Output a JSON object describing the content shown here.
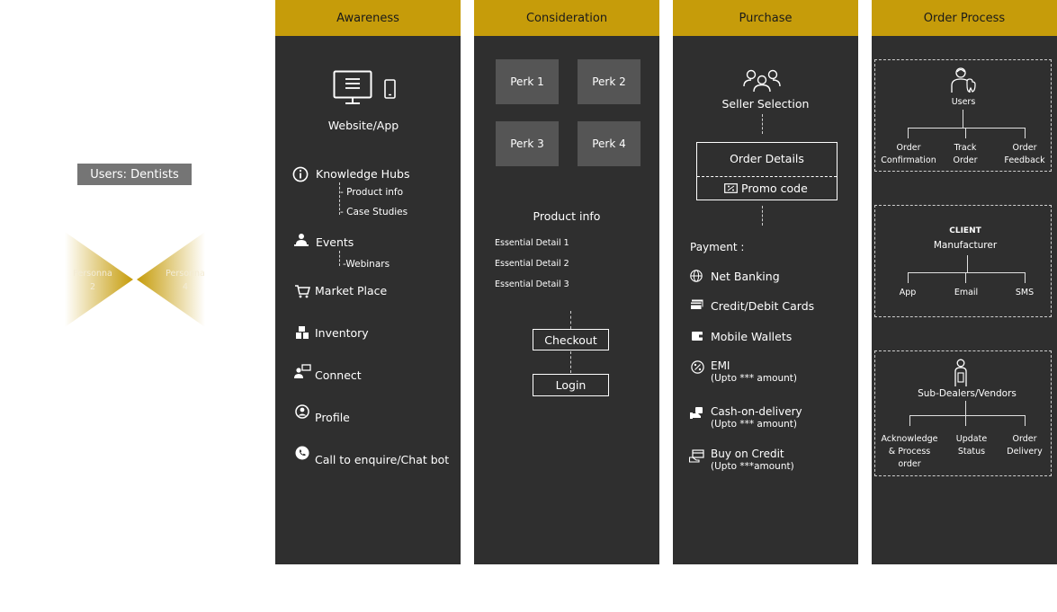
{
  "left": {
    "users_label": "Users: Dentists",
    "persona_left": [
      "Personna",
      "2"
    ],
    "persona_right": [
      "Personna",
      "4"
    ]
  },
  "awareness": {
    "title": "Awareness",
    "website": "Website/App",
    "knowledge_hubs": "Knowledge Hubs",
    "product_info": "- Product info",
    "case_studies": "- Case Studies",
    "events": "Events",
    "webinars": "-Webinars",
    "market_place": "Market Place",
    "inventory": "Inventory",
    "connect": "Connect",
    "profile": "Profile",
    "call": "Call to enquire/Chat bot"
  },
  "consideration": {
    "title": "Consideration",
    "perks": [
      "Perk 1",
      "Perk 2",
      "Perk 3",
      "Perk 4"
    ],
    "product_info": "Product info",
    "details": [
      "Essential Detail 1",
      "Essential Detail 2",
      "Essential Detail 3"
    ],
    "checkout": "Checkout",
    "login": "Login"
  },
  "purchase": {
    "title": "Purchase",
    "seller": "Seller Selection",
    "order_details": "Order Details",
    "promo": "Promo code",
    "payment": "Payment :",
    "net_banking": "Net Banking",
    "cards": "Credit/Debit Cards",
    "wallets": "Mobile Wallets",
    "emi": "EMI",
    "emi_sub": "(Upto *** amount)",
    "cod": "Cash-on-delivery",
    "cod_sub": "(Upto *** amount)",
    "credit": "Buy on Credit",
    "credit_sub": "(Upto ***amount)"
  },
  "order": {
    "title": "Order Process",
    "users": "Users",
    "users_children": [
      [
        "Order",
        "Confirmation"
      ],
      [
        "Track",
        "Order"
      ],
      [
        "Order",
        "Feedback"
      ]
    ],
    "client": "CLIENT",
    "manufacturer": "Manufacturer",
    "client_children": [
      "App",
      "Email",
      "SMS"
    ],
    "sub_dealers": "Sub-Dealers/Vendors",
    "sub_children": [
      [
        "Acknowledge",
        "& Process",
        "order"
      ],
      [
        "Update",
        "Status"
      ],
      [
        "Order",
        "Delivery"
      ]
    ]
  },
  "colors": {
    "accent": "#c69c0a",
    "panel": "#2f2f2f",
    "perk": "#555555",
    "label_bg": "#757575"
  }
}
